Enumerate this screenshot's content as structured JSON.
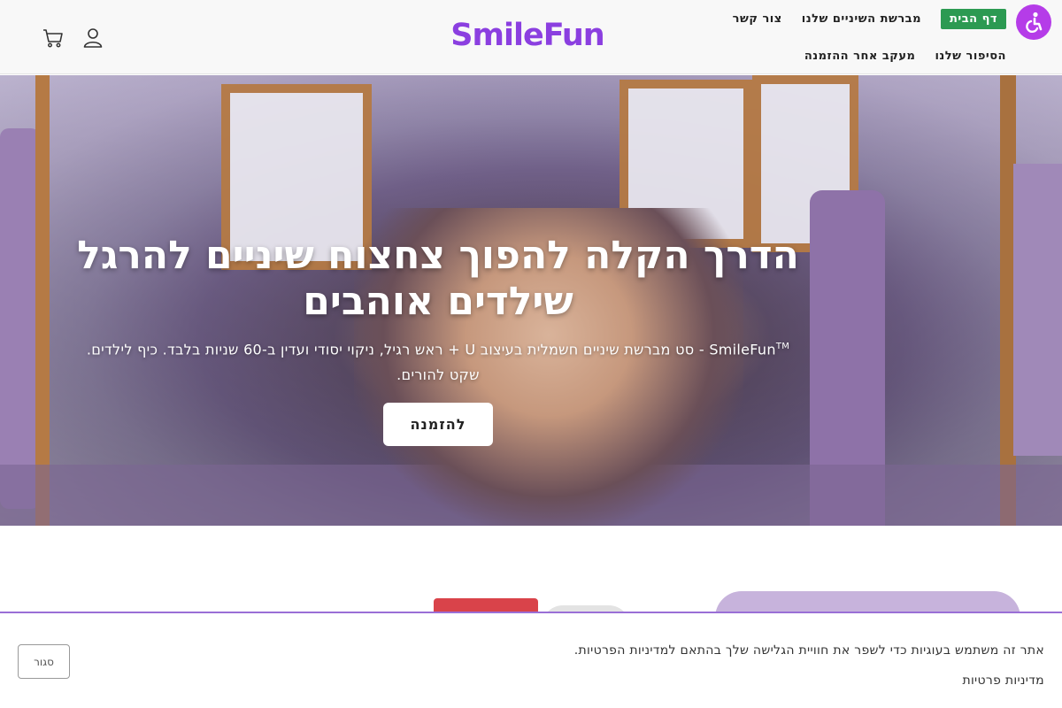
{
  "header": {
    "logo": "SmileFun",
    "nav_row1": [
      "דף הבית",
      "מברשת השיניים שלנו",
      "צור קשר"
    ],
    "nav_row2": [
      "הסיפור שלנו",
      "מעקב אחר ההזמנה"
    ],
    "active_nav": "דף הבית",
    "icons": [
      "accessibility-icon",
      "cart-icon",
      "account-icon"
    ]
  },
  "hero": {
    "title": "הדרך הקלה להפוך צחצוח שיניים להרגל שילדים אוהבים",
    "subtitle_brand": "SmileFun",
    "subtitle_tm": "TM",
    "subtitle_rest": " - סט מברשת שיניים חשמלית בעיצוב U + ראש רגיל, ניקוי יסודי ועדין ב-60 שניות בלבד. כיף לילדים. שקט להורים.",
    "cta": "להזמנה"
  },
  "cookie_bar": {
    "text": "אתר זה משתמש בעוגיות כדי לשפר את חוויית הגלישה שלך בהתאם למדיניות הפרטיות.",
    "link": "מדיניות פרטיות",
    "close": "סגור"
  },
  "colors": {
    "brand": "#8b3fe0",
    "accessibility": "#b53ce8",
    "active_nav": "#2c9a52",
    "cookie_border": "#9a6fd6"
  }
}
